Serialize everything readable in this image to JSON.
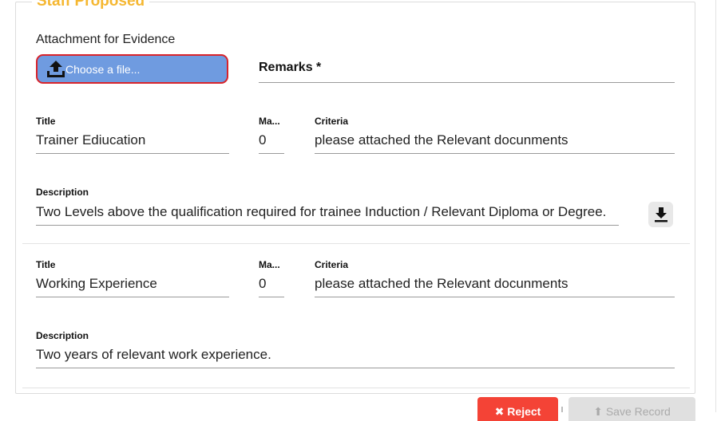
{
  "panel": {
    "legend": "Staff Proposed"
  },
  "attachment": {
    "label": "Attachment for Evidence",
    "choose_label": "Choose a file..."
  },
  "remarks": {
    "label": "Remarks *"
  },
  "rows": [
    {
      "title_label": "Title",
      "title_value": "Trainer Ediucation",
      "marks_label": "Ma...",
      "marks_value": "0",
      "criteria_label": "Criteria",
      "criteria_value": "please attached the Relevant docunments",
      "description_label": "Description",
      "description_value": "Two Levels above the qualification required for trainee Induction / Relevant Diploma or Degree."
    },
    {
      "title_label": "Title",
      "title_value": "Working Experience",
      "marks_label": "Ma...",
      "marks_value": "0",
      "criteria_label": "Criteria",
      "criteria_value": "please attached the Relevant docunments",
      "description_label": "Description",
      "description_value": "Two years of relevant work experience."
    }
  ],
  "actions": {
    "reject_label": "✖ Reject",
    "save_label": "⬆ Save Record"
  },
  "icons": {
    "upload": "upload-icon",
    "download": "download-icon"
  },
  "colors": {
    "legend": "#f5b731",
    "file_button": "#6f9be0",
    "file_button_border": "#d8232a",
    "reject": "#f44336"
  }
}
